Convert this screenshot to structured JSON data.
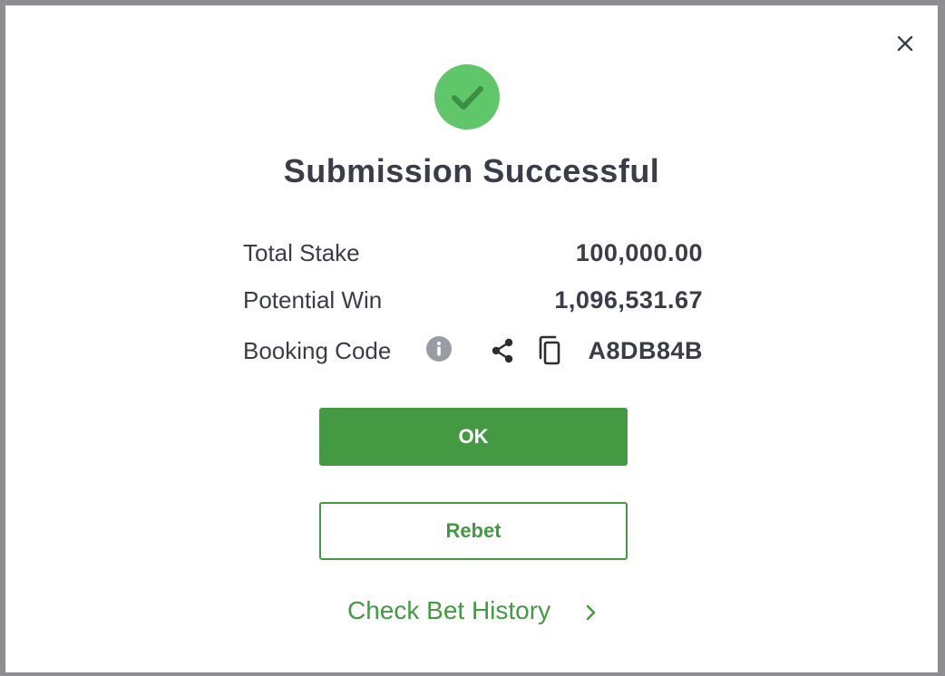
{
  "dialog": {
    "title": "Submission Successful",
    "close_icon": "close-icon",
    "status_icon": "check-circle-icon"
  },
  "summary": {
    "total_stake_label": "Total Stake",
    "total_stake_value": "100,000.00",
    "potential_win_label": "Potential Win",
    "potential_win_value": "1,096,531.67",
    "booking_code_label": "Booking Code",
    "booking_code_value": "A8DB84B",
    "icons": [
      "info-icon",
      "share-icon",
      "copy-icon"
    ]
  },
  "actions": {
    "ok_label": "OK",
    "rebet_label": "Rebet",
    "history_label": "Check Bet History"
  },
  "colors": {
    "primary_green": "#439a43",
    "success_green": "#5fc76a",
    "text_dark": "#3a3d47",
    "info_grey": "#9a9ca5",
    "overlay": "#8e8e92"
  }
}
